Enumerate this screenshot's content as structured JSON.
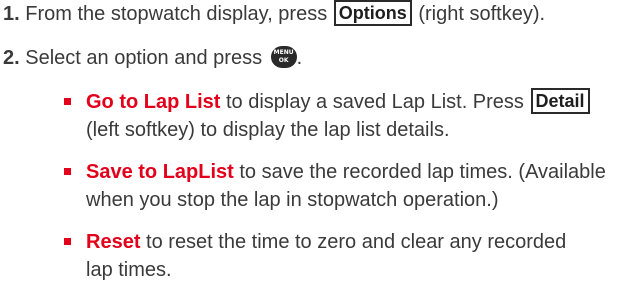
{
  "steps": [
    {
      "number": "1.",
      "text_before": " From the stopwatch display, press ",
      "key": "Options",
      "text_after": " (right softkey)."
    },
    {
      "number": "2.",
      "text_before": " Select an option and press ",
      "menu_key_top": "MENU",
      "menu_key_bottom": "OK",
      "text_after": "."
    }
  ],
  "bullets": [
    {
      "term": "Go to Lap List",
      "text_before": " to display a saved Lap List. Press ",
      "key": "Detail",
      "text_after_line1": "",
      "text_line2": "(left softkey) to display the lap list details."
    },
    {
      "term": "Save to LapList",
      "text_line1": " to save the recorded lap times. (Available",
      "text_line2": "when you stop the lap in stopwatch operation.)"
    },
    {
      "term": "Reset",
      "text_line1": " to reset the time to zero and clear any recorded",
      "text_line2": "lap times."
    }
  ],
  "colors": {
    "accent_red": "#e2001a",
    "body_text": "#3a3a3a"
  }
}
